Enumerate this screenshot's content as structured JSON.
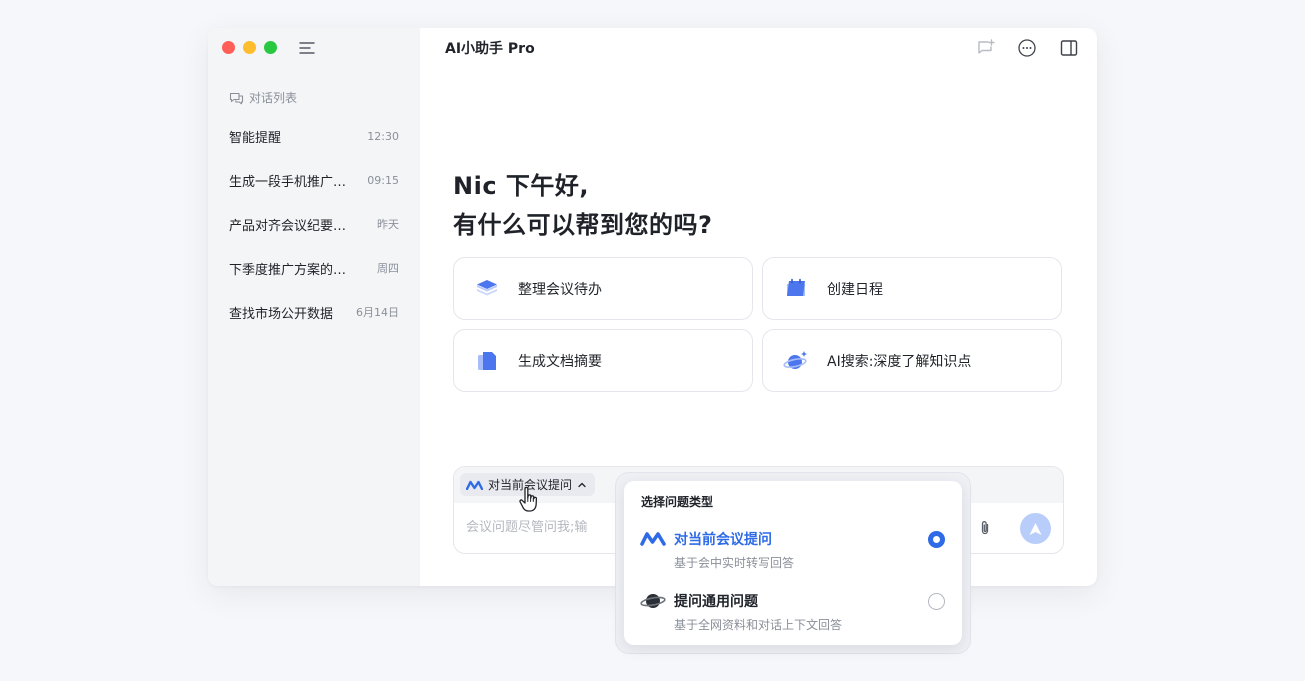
{
  "app": {
    "title": "AI小助手 Pro"
  },
  "sidebar": {
    "section_label": "对话列表",
    "conversations": [
      {
        "title": "智能提醒",
        "time": "12:30"
      },
      {
        "title": "生成一段手机推广…",
        "time": "09:15"
      },
      {
        "title": "产品对齐会议纪要…",
        "time": "昨天"
      },
      {
        "title": "下季度推广方案的…",
        "time": "周四"
      },
      {
        "title": "查找市场公开数据",
        "time": "6月14日"
      }
    ]
  },
  "greeting": {
    "line1": "Nic 下午好,",
    "line2": "有什么可以帮到您的吗?"
  },
  "cards": [
    {
      "label": "整理会议待办",
      "icon": "layers-icon"
    },
    {
      "label": "创建日程",
      "icon": "calendar-icon"
    },
    {
      "label": "生成文档摘要",
      "icon": "document-icon"
    },
    {
      "label": "AI搜索:深度了解知识点",
      "icon": "planet-search-icon"
    }
  ],
  "input": {
    "mode_label": "对当前会议提问",
    "placeholder": "会议问题尽管问我;输"
  },
  "popover": {
    "title": "选择问题类型",
    "options": [
      {
        "title": "对当前会议提问",
        "desc": "基于会中实时转写回答",
        "selected": true,
        "icon": "meeting-logo-icon"
      },
      {
        "title": "提问通用问题",
        "desc": "基于全网资料和对话上下文回答",
        "selected": false,
        "icon": "planet-icon"
      }
    ]
  },
  "colors": {
    "accent": "#2f6be6",
    "accent_light": "#b9cdfb",
    "sidebar_bg": "#f4f5f7",
    "text_primary": "#1f2329",
    "text_secondary": "#8a8f99"
  }
}
